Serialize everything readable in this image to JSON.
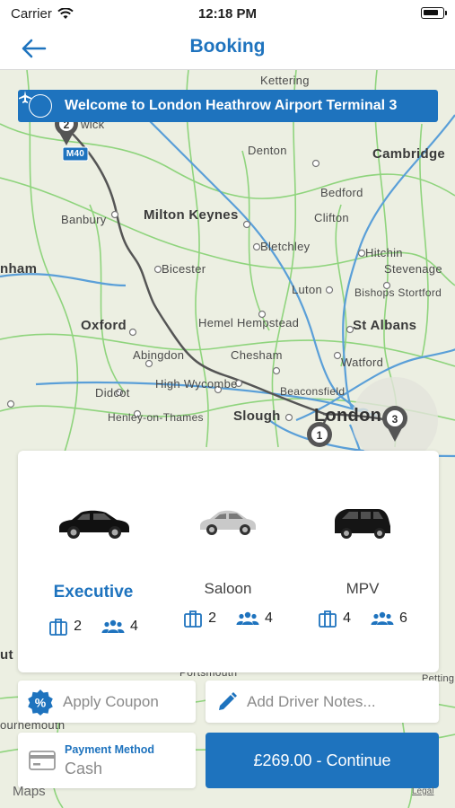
{
  "status_bar": {
    "carrier": "Carrier",
    "time": "12:18 PM"
  },
  "nav": {
    "title": "Booking",
    "back_icon": "arrow-left-icon"
  },
  "map": {
    "banner": "Welcome to London Heathrow Airport Terminal 3",
    "labels": {
      "kettering": "Kettering",
      "warwick": "wick",
      "m40": "M40",
      "denton": "Denton",
      "cambridge": "Cambridge",
      "bedford": "Bedford",
      "banbury": "Banbury",
      "milton_keynes": "Milton Keynes",
      "clifton": "Clifton",
      "bletchley": "Bletchley",
      "hitchin": "Hitchin",
      "stevenage": "Stevenage",
      "bicester": "Bicester",
      "luton": "Luton",
      "bishops_stortford": "Bishops Stortford",
      "nham": "nham",
      "oxford": "Oxford",
      "hemel": "Hemel Hempstead",
      "st_albans": "St Albans",
      "abingdon": "Abingdon",
      "chesham": "Chesham",
      "watford": "Watford",
      "didcot": "Didcot",
      "high_wycombe": "High Wycombe",
      "beaconsfield": "Beaconsfield",
      "henley": "Henley-on-Thames",
      "slough": "Slough",
      "london": "London",
      "portsmouth": "Portsmouth",
      "petting": "Petting",
      "uth": "ut",
      "ournemouth": "ournemouth",
      "maps": "Maps",
      "legal": "Legal"
    },
    "pins": [
      "1",
      "2",
      "3"
    ]
  },
  "vehicles": [
    {
      "name": "Executive",
      "luggage": "2",
      "passengers": "4",
      "selected": true
    },
    {
      "name": "Saloon",
      "luggage": "2",
      "passengers": "4",
      "selected": false
    },
    {
      "name": "MPV",
      "luggage": "4",
      "passengers": "6",
      "selected": false
    }
  ],
  "coupon": {
    "label": "Apply Coupon",
    "icon": "percent-badge-icon"
  },
  "notes": {
    "label": "Add Driver Notes...",
    "icon": "pencil-icon"
  },
  "payment": {
    "label": "Payment Method",
    "value": "Cash",
    "icon": "card-icon"
  },
  "continue_label": "£269.00 - Continue",
  "colors": {
    "accent": "#1e73be",
    "route": "#555555",
    "motorway": "#3c8cd0",
    "road": "#7ccf6a"
  }
}
